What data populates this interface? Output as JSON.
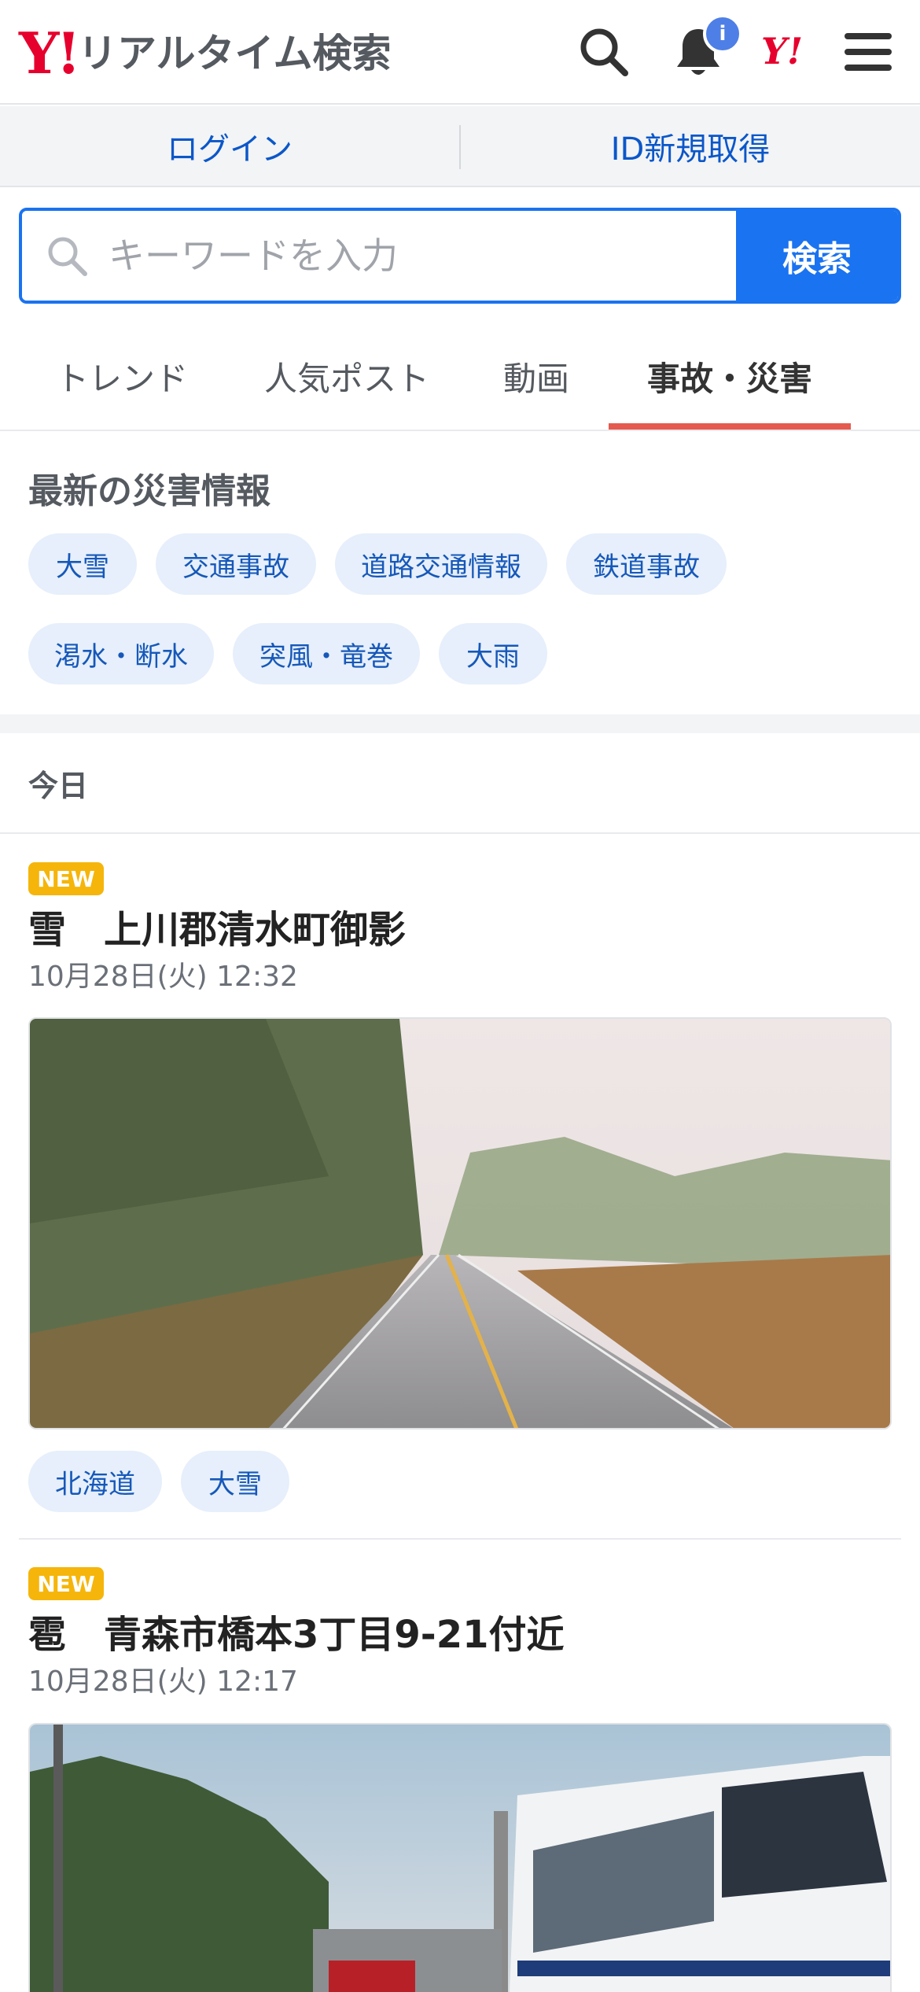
{
  "header": {
    "logo_mark": "Y!",
    "logo_text": "リアルタイム検索",
    "notification_badge": "i",
    "yahoo_mini": "Y!"
  },
  "account": {
    "login": "ログイン",
    "register": "ID新規取得"
  },
  "search": {
    "placeholder": "キーワードを入力",
    "button": "検索"
  },
  "tabs": [
    {
      "label": "トレンド",
      "active": false
    },
    {
      "label": "人気ポスト",
      "active": false
    },
    {
      "label": "動画",
      "active": false
    },
    {
      "label": "事故・災害",
      "active": true
    }
  ],
  "disaster": {
    "title": "最新の災害情報",
    "chips": [
      "大雪",
      "交通事故",
      "道路交通情報",
      "鉄道事故",
      "渇水・断水",
      "突風・竜巻",
      "大雨"
    ]
  },
  "timeline": {
    "day_label": "今日"
  },
  "posts": [
    {
      "badge": "NEW",
      "title": "雪　上川郡清水町御影",
      "date": "10月28日(火) 12:32",
      "tags": [
        "北海道",
        "大雪"
      ]
    },
    {
      "badge": "NEW",
      "title": "雹　青森市橋本3丁目9-21付近",
      "date": "10月28日(火) 12:17",
      "tags": []
    }
  ],
  "colors": {
    "brand_red": "#e6002d",
    "accent_blue": "#1a73f0",
    "link_blue": "#0b57c9",
    "tab_underline": "#e55a4e",
    "new_badge": "#f5b50a"
  }
}
